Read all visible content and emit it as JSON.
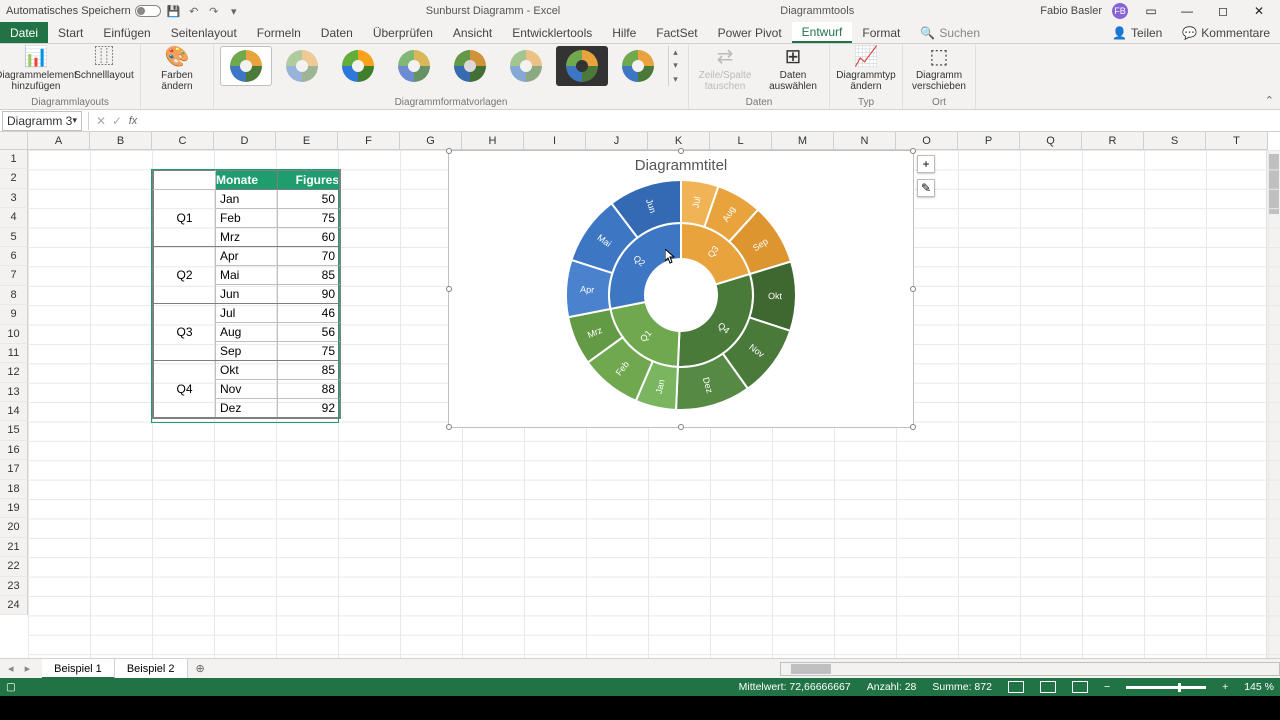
{
  "titlebar": {
    "autosave": "Automatisches Speichern",
    "doc_title": "Sunburst Diagramm - Excel",
    "context_title": "Diagrammtools",
    "user": "Fabio Basler",
    "avatar": "FB"
  },
  "tabs": {
    "file": "Datei",
    "list": [
      "Start",
      "Einfügen",
      "Seitenlayout",
      "Formeln",
      "Daten",
      "Überprüfen",
      "Ansicht",
      "Entwicklertools",
      "Hilfe",
      "FactSet",
      "Power Pivot",
      "Entwurf",
      "Format"
    ],
    "active": "Entwurf",
    "search_placeholder": "Suchen",
    "share": "Teilen",
    "comments": "Kommentare"
  },
  "ribbon": {
    "grp_layouts": "Diagrammlayouts",
    "btn_add_element": "Diagrammelement hinzufügen",
    "btn_quick_layout": "Schnelllayout",
    "btn_change_colors": "Farben ändern",
    "grp_styles": "Diagrammformatvorlagen",
    "grp_data": "Daten",
    "btn_swap": "Zeile/Spalte tauschen",
    "btn_select_data": "Daten auswählen",
    "grp_type": "Typ",
    "btn_change_type": "Diagrammtyp ändern",
    "grp_location": "Ort",
    "btn_move": "Diagramm verschieben"
  },
  "namebox": "Diagramm 3",
  "columns": [
    "A",
    "B",
    "C",
    "D",
    "E",
    "F",
    "G",
    "H",
    "I",
    "J",
    "K",
    "L",
    "M",
    "N",
    "O",
    "P",
    "Q",
    "R",
    "S",
    "T"
  ],
  "table": {
    "h_month": "Monate",
    "h_figures": "Figures",
    "quarters": [
      "Q1",
      "Q2",
      "Q3",
      "Q4"
    ],
    "rows": [
      [
        "Jan",
        50
      ],
      [
        "Feb",
        75
      ],
      [
        "Mrz",
        60
      ],
      [
        "Apr",
        70
      ],
      [
        "Mai",
        85
      ],
      [
        "Jun",
        90
      ],
      [
        "Jul",
        46
      ],
      [
        "Aug",
        56
      ],
      [
        "Sep",
        75
      ],
      [
        "Okt",
        85
      ],
      [
        "Nov",
        88
      ],
      [
        "Dez",
        92
      ]
    ]
  },
  "chart": {
    "title": "Diagrammtitel"
  },
  "chart_data": {
    "type": "sunburst",
    "title": "Diagrammtitel",
    "inner_ring": [
      {
        "name": "Q1",
        "value": 185,
        "color": "#6fa84f"
      },
      {
        "name": "Q2",
        "value": 245,
        "color": "#3d76c2"
      },
      {
        "name": "Q3",
        "value": 177,
        "color": "#e8a33d"
      },
      {
        "name": "Q4",
        "value": 265,
        "color": "#4a7a3a"
      }
    ],
    "outer_ring": [
      {
        "parent": "Q1",
        "name": "Jan",
        "value": 50,
        "color": "#6fa84f"
      },
      {
        "parent": "Q1",
        "name": "Feb",
        "value": 75,
        "color": "#6fa84f"
      },
      {
        "parent": "Q1",
        "name": "Mrz",
        "value": 60,
        "color": "#6fa84f"
      },
      {
        "parent": "Q2",
        "name": "Apr",
        "value": 70,
        "color": "#3d76c2"
      },
      {
        "parent": "Q2",
        "name": "Mai",
        "value": 85,
        "color": "#3d76c2"
      },
      {
        "parent": "Q2",
        "name": "Jun",
        "value": 90,
        "color": "#3d76c2"
      },
      {
        "parent": "Q3",
        "name": "Jul",
        "value": 46,
        "color": "#e8a33d"
      },
      {
        "parent": "Q3",
        "name": "Aug",
        "value": 56,
        "color": "#e8a33d"
      },
      {
        "parent": "Q3",
        "name": "Sep",
        "value": 75,
        "color": "#e8a33d"
      },
      {
        "parent": "Q4",
        "name": "Okt",
        "value": 85,
        "color": "#4a7a3a"
      },
      {
        "parent": "Q4",
        "name": "Nov",
        "value": 88,
        "color": "#4a7a3a"
      },
      {
        "parent": "Q4",
        "name": "Dez",
        "value": 92,
        "color": "#4a7a3a"
      }
    ]
  },
  "sheets": {
    "tab1": "Beispiel 1",
    "tab2": "Beispiel 2"
  },
  "status": {
    "avg_label": "Mittelwert:",
    "avg": "72,66666667",
    "count_label": "Anzahl:",
    "count": "28",
    "sum_label": "Summe:",
    "sum": "872",
    "zoom": "145 %"
  }
}
